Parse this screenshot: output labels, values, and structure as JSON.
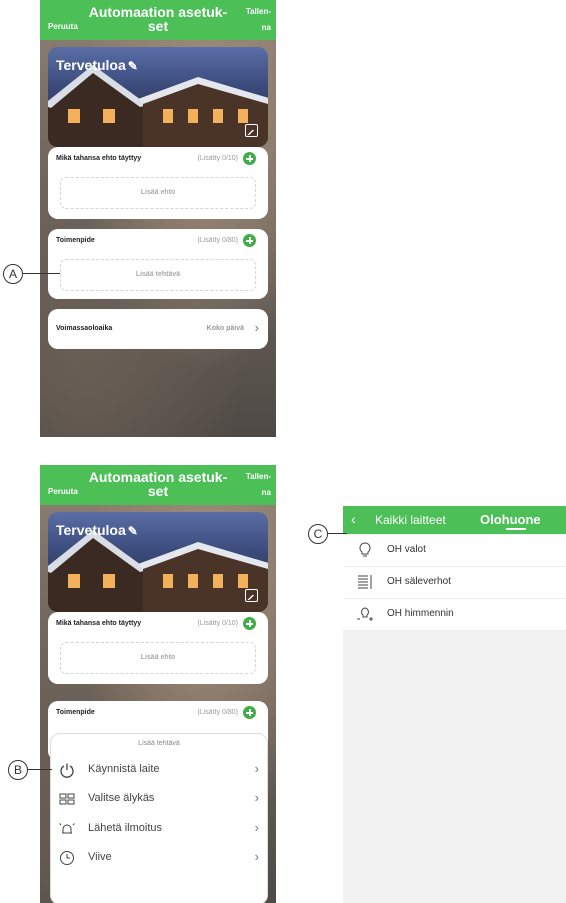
{
  "top_panel": {
    "cancel": "Peruuta",
    "title": "Automaation asetuk-set",
    "save": "Tallen-na",
    "welcome": "Tervetuloa",
    "condition_card": {
      "title": "Mikä tahansa ehto täyttyy",
      "count": "(Lisätty 0/10)",
      "add": "Lisää ehto"
    },
    "action_card": {
      "title": "Toimenpide",
      "count": "(Lisätty 0/80)",
      "add": "Lisää tehtävä"
    },
    "validity": {
      "label": "Voimassaoloaika",
      "value": "Koko päivä"
    }
  },
  "bottom_panel": {
    "cancel": "Peruuta",
    "title": "Automaation asetuk-set",
    "save": "Tallen-na",
    "welcome": "Tervetuloa",
    "condition_card": {
      "title": "Mikä tahansa ehto täyttyy",
      "count": "(Lisätty 0/10)",
      "add": "Lisää ehto"
    },
    "action_card": {
      "title": "Toimenpide",
      "count": "(Lisätty 0/80)"
    },
    "sheet": {
      "title": "Lisää tehtävä",
      "options": [
        {
          "label": "Käynnistä laite",
          "icon": "power-icon"
        },
        {
          "label": "Valitse älykäs",
          "icon": "grid-icon"
        },
        {
          "label": "Lähetä ilmoitus",
          "icon": "alarm-bell-icon"
        },
        {
          "label": "Viive",
          "icon": "clock-icon"
        }
      ]
    }
  },
  "device_panel": {
    "tab_all": "Kaikki laitteet",
    "tab_room": "Olohuone",
    "devices": [
      {
        "label": "OH valot",
        "icon": "bulb-icon"
      },
      {
        "label": "OH säleverhot",
        "icon": "blinds-icon"
      },
      {
        "label": "OH himmennin",
        "icon": "dimmer-icon"
      }
    ]
  },
  "callouts": {
    "a": "A",
    "b": "B",
    "c": "C"
  },
  "colors": {
    "accent": "#4cbf57",
    "add_button": "#3fae49"
  }
}
